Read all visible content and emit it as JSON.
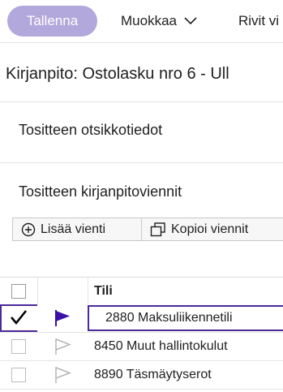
{
  "toolbar": {
    "save_label": "Tallenna",
    "edit_label": "Muokkaa",
    "rows_label": "Rivit vi"
  },
  "page": {
    "title": "Kirjanpito: Ostolasku nro 6 - Ull"
  },
  "sections": {
    "header_title": "Tositteen otsikkotiedot",
    "entries_title": "Tositteen kirjanpitoviennit"
  },
  "actions": {
    "add_entry": "Lisää vienti",
    "copy_entries": "Kopioi viennit"
  },
  "grid": {
    "account_header": "Tili",
    "rows": [
      {
        "account": "2880 Maksuliikennetili",
        "checked": true,
        "flagged": true
      },
      {
        "account": "8450 Muut hallintokulut",
        "checked": false,
        "flagged": false
      },
      {
        "account": "8890 Täsmäytyserot",
        "checked": false,
        "flagged": false
      }
    ]
  },
  "colors": {
    "accent": "#b3a8db",
    "selection": "#4a2a9a",
    "flag": "#3a10a8"
  }
}
